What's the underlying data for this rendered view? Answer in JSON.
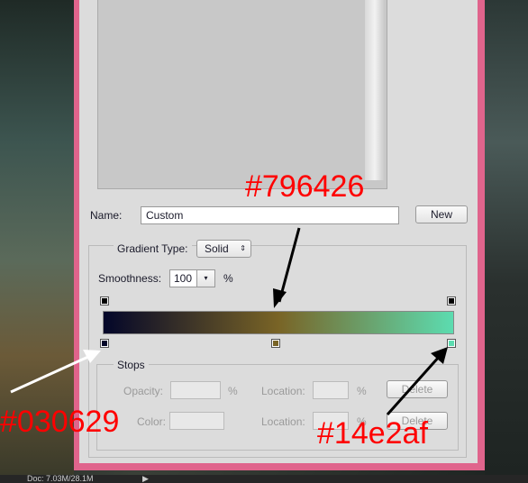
{
  "dialog": {
    "name_label": "Name:",
    "name_value": "Custom",
    "new_button": "New",
    "gradient_type_label": "Gradient Type:",
    "gradient_type_value": "Solid",
    "smoothness_label": "Smoothness:",
    "smoothness_value": "100",
    "smoothness_unit": "%",
    "gradient_colors": [
      "#030629",
      "#796426",
      "#5cdcb0"
    ],
    "stops": {
      "title": "Stops",
      "opacity_label": "Opacity:",
      "opacity_unit": "%",
      "location_label": "Location:",
      "location_unit": "%",
      "delete_label": "Delete",
      "color_label": "Color:"
    }
  },
  "annotations": {
    "mid": "#796426",
    "left": "#030629",
    "right": "#14e2af"
  },
  "status": {
    "doc": "Doc: 7.03M/28.1M"
  }
}
